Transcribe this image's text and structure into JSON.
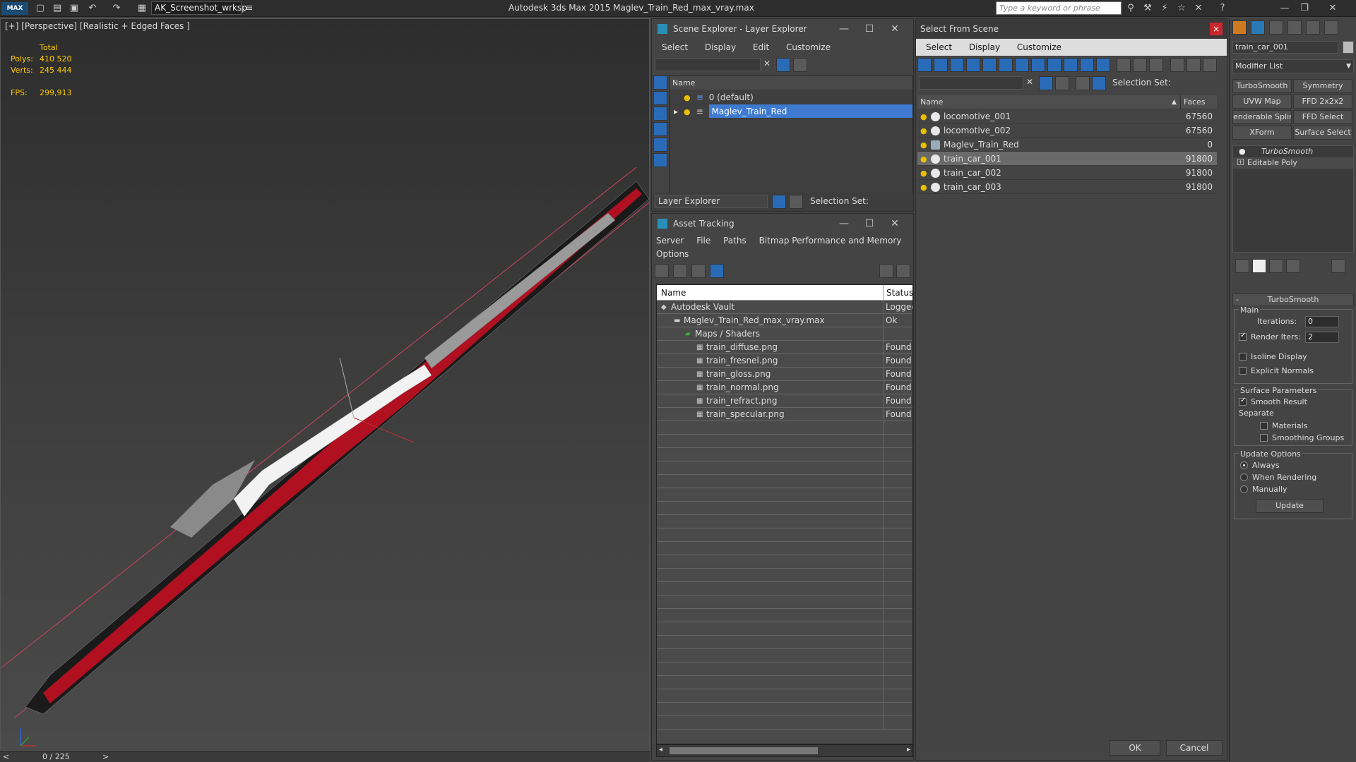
{
  "titlebar": {
    "logo": "MAX",
    "workspace": "AK_Screenshot_wrksp",
    "app_title": "Autodesk 3ds Max  2015     Maglev_Train_Red_max_vray.max",
    "search_placeholder": "Type a keyword or phrase"
  },
  "viewport": {
    "label": "[+] [Perspective] [Realistic + Edged Faces ]",
    "stats": {
      "total_label": "Total",
      "polys_label": "Polys:",
      "polys": "410 520",
      "verts_label": "Verts:",
      "verts": "245 444",
      "fps_label": "FPS:",
      "fps": "299,913"
    }
  },
  "timeline": {
    "prev": "<",
    "counter": "0 / 225",
    "next": ">"
  },
  "scene_explorer": {
    "title": "Scene Explorer - Layer Explorer",
    "menu": [
      "Select",
      "Display",
      "Edit",
      "Customize"
    ],
    "col_name": "Name",
    "rows": [
      "0 (default)",
      "Maglev_Train_Red"
    ],
    "footer_dropdown": "Layer Explorer",
    "selection_set": "Selection Set:"
  },
  "asset_tracking": {
    "title": "Asset Tracking",
    "menu": [
      "Server",
      "File",
      "Paths",
      "Bitmap Performance and Memory"
    ],
    "menu2": "Options",
    "col_name": "Name",
    "col_status": "Status",
    "rows": [
      {
        "name": "Autodesk Vault",
        "status": "Logged"
      },
      {
        "name": "Maglev_Train_Red_max_vray.max",
        "status": "Ok"
      },
      {
        "name": "Maps / Shaders",
        "status": ""
      },
      {
        "name": "train_diffuse.png",
        "status": "Found"
      },
      {
        "name": "train_fresnel.png",
        "status": "Found"
      },
      {
        "name": "train_gloss.png",
        "status": "Found"
      },
      {
        "name": "train_normal.png",
        "status": "Found"
      },
      {
        "name": "train_refract.png",
        "status": "Found"
      },
      {
        "name": "train_specular.png",
        "status": "Found"
      }
    ]
  },
  "select_from_scene": {
    "title": "Select From Scene",
    "close": "×",
    "menu": [
      "Select",
      "Display",
      "Customize"
    ],
    "selection_set": "Selection Set:",
    "col_name": "Name",
    "col_faces": "Faces",
    "rows": [
      {
        "name": "locomotive_001",
        "faces": "67560"
      },
      {
        "name": "locomotive_002",
        "faces": "67560"
      },
      {
        "name": "Maglev_Train_Red",
        "faces": "0"
      },
      {
        "name": "train_car_001",
        "faces": "91800"
      },
      {
        "name": "train_car_002",
        "faces": "91800"
      },
      {
        "name": "train_car_003",
        "faces": "91800"
      }
    ],
    "ok": "OK",
    "cancel": "Cancel"
  },
  "command_panel": {
    "object_name": "train_car_001",
    "modifier_list": "Modifier List",
    "buttons": [
      "TurboSmooth",
      "Symmetry",
      "UVW Map",
      "FFD 2x2x2",
      "enderable Splin",
      "FFD Select",
      "XForm",
      "Surface Select"
    ],
    "stack": [
      "TurboSmooth",
      "Editable Poly"
    ],
    "rollout_title": "TurboSmooth",
    "main_label": "Main",
    "iterations_label": "Iterations:",
    "iterations": "0",
    "render_iters_label": "Render Iters:",
    "render_iters": "2",
    "isoline": "Isoline Display",
    "explicit_normals": "Explicit Normals",
    "surface_params": "Surface Parameters",
    "smooth_result": "Smooth Result",
    "separate": "Separate",
    "materials": "Materials",
    "smoothing_groups": "Smoothing Groups",
    "update_options": "Update Options",
    "always": "Always",
    "when_rendering": "When Rendering",
    "manually": "Manually",
    "update": "Update"
  }
}
